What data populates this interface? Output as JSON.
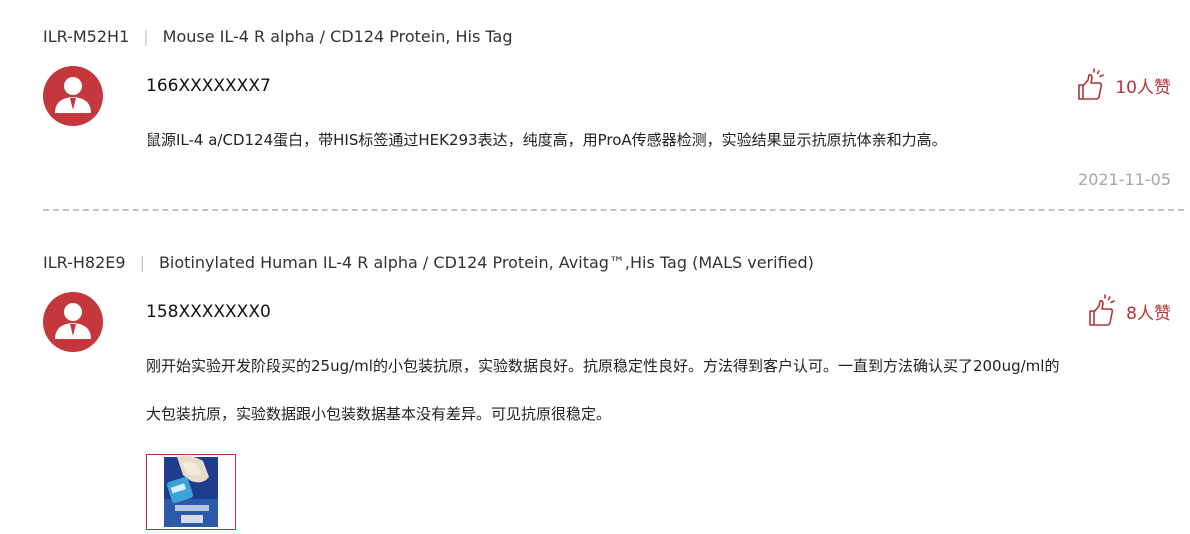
{
  "reviews": [
    {
      "product_code": "ILR-M52H1",
      "separator": "|",
      "product_name": "Mouse IL-4 R alpha / CD124 Protein, His Tag",
      "user": "166XXXXXXX7",
      "likes": "10人赞",
      "content_lines": [
        "鼠源IL-4 a/CD124蛋白，带HIS标签通过HEK293表达，纯度高，用ProA传感器检测，实验结果显示抗原抗体亲和力高。"
      ],
      "date": "2021-11-05"
    },
    {
      "product_code": "ILR-H82E9",
      "separator": "|",
      "product_name": "Biotinylated Human IL-4 R alpha / CD124 Protein, Avitag™,His Tag (MALS verified)",
      "user": "158XXXXXXX0",
      "likes": "8人赞",
      "content_lines": [
        "刚开始实验开发阶段买的25ug/ml的小包装抗原，实验数据良好。抗原稳定性良好。方法得到客户认可。一直到方法确认买了200ug/ml的",
        "大包装抗原，实验数据跟小包装数据基本没有差异。可见抗原很稳定。"
      ]
    }
  ],
  "colors": {
    "accent": "#b2343b",
    "avatar_bg": "#c4373c",
    "date": "#a6a6a6",
    "divider": "#c2c2c2"
  }
}
